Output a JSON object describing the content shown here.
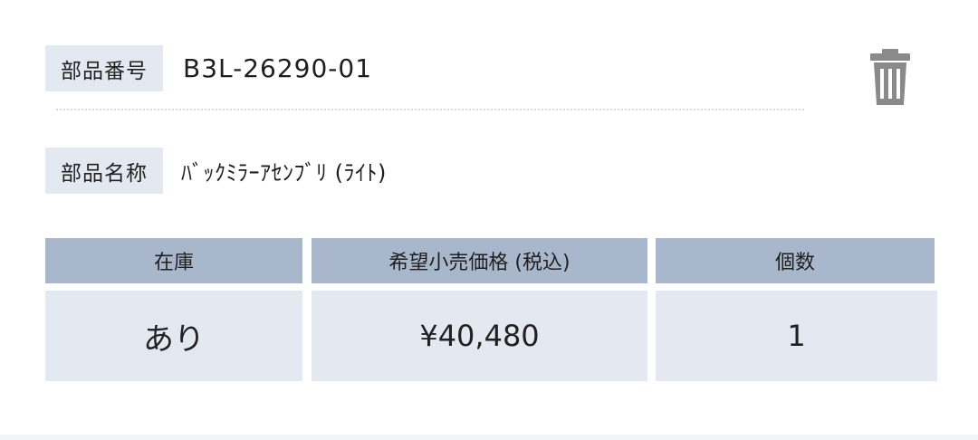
{
  "part": {
    "number_label": "部品番号",
    "number_value": "B3L-26290-01",
    "name_label": "部品名称",
    "name_value": "ﾊﾞｯｸﾐﾗｰｱｾﾝﾌﾞﾘ (ﾗｲﾄ)"
  },
  "actions": {
    "delete_icon": "trash-icon"
  },
  "table": {
    "headers": [
      "在庫",
      "希望小売価格 (税込)",
      "個数"
    ],
    "row": [
      "あり",
      "¥40,480",
      "1"
    ]
  },
  "colors": {
    "label_bg": "#e3e8f1",
    "header_bg": "#a9b7cc",
    "icon": "#8a8a8a"
  }
}
